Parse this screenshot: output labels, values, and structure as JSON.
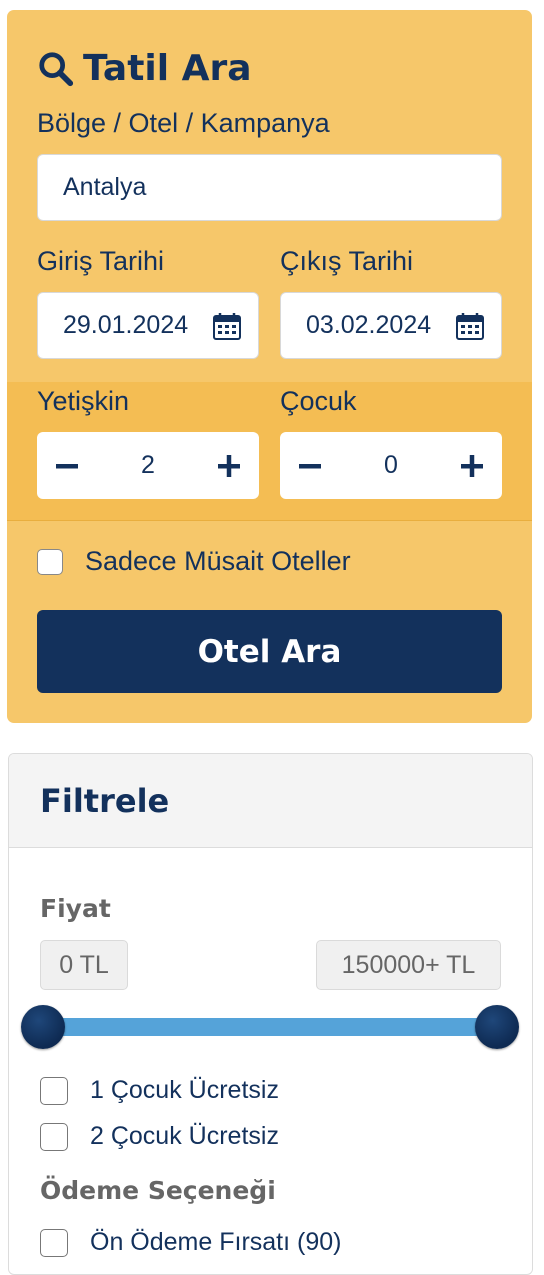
{
  "search": {
    "title": "Tatil Ara",
    "region_label": "Bölge / Otel / Kampanya",
    "region_value": "Antalya",
    "checkin_label": "Giriş Tarihi",
    "checkin_value": "29.01.2024",
    "checkout_label": "Çıkış Tarihi",
    "checkout_value": "03.02.2024",
    "adult_label": "Yetişkin",
    "adult_value": "2",
    "child_label": "Çocuk",
    "child_value": "0",
    "available_only_label": "Sadece Müsait Oteller",
    "available_only_checked": false,
    "search_button": "Otel Ara"
  },
  "filter": {
    "title": "Filtrele",
    "price_label": "Fiyat",
    "price_min": "0 TL",
    "price_max": "150000+ TL",
    "price_range_fraction": [
      0,
      1
    ],
    "options": [
      {
        "label": "1 Çocuk Ücretsiz",
        "checked": false
      },
      {
        "label": "2 Çocuk Ücretsiz",
        "checked": false
      }
    ],
    "payment_label": "Ödeme Seçeneği",
    "payment_options": [
      {
        "label": "Ön Ödeme Fırsatı (90)",
        "checked": false
      }
    ]
  },
  "colors": {
    "panel": "#f6c76a",
    "guest_band": "#f4bd53",
    "primary": "#13315c",
    "slider": "#55a3d9"
  },
  "icons": [
    "search-icon",
    "calendar-icon",
    "minus-icon",
    "plus-icon",
    "checkbox-icon"
  ]
}
